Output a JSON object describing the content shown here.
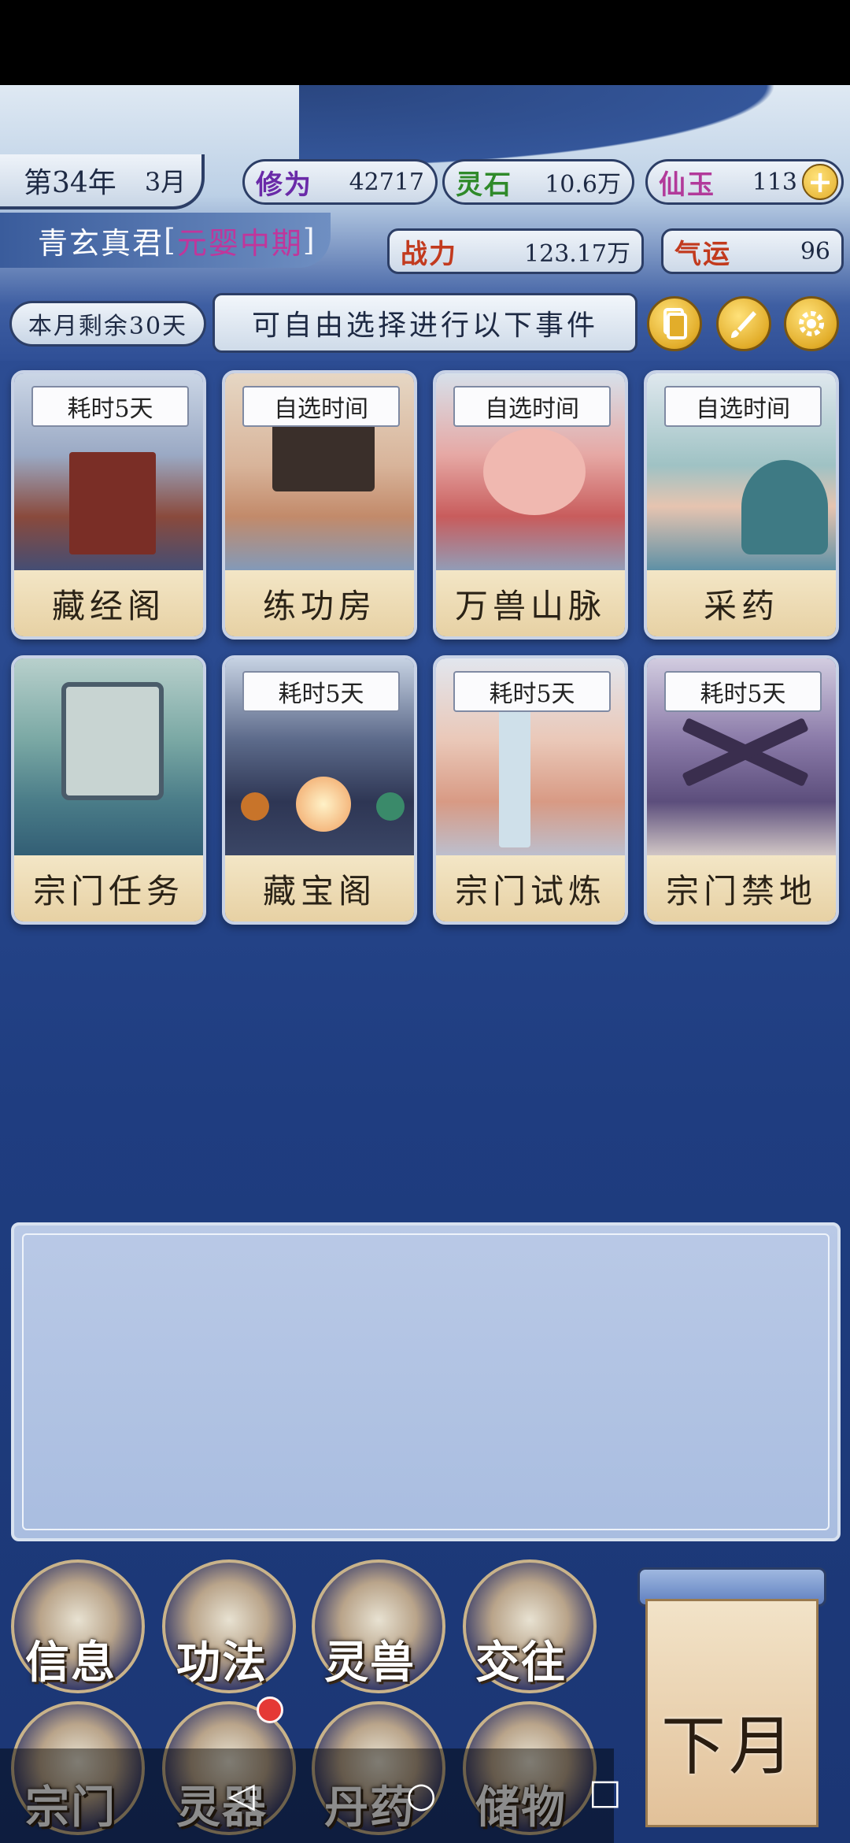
{
  "header": {
    "year": "第34年",
    "month": "3月",
    "cultivation_label": "修为",
    "cultivation_value": "42717",
    "spirit_stone_label": "灵石",
    "spirit_stone_value": "10.6万",
    "jade_label": "仙玉",
    "jade_value": "113",
    "player_name": "青玄真君",
    "realm_open": "[",
    "realm": "元婴中期",
    "realm_close": "]",
    "power_label": "战力",
    "power_value": "123.17万",
    "luck_label": "气运",
    "luck_value": "96",
    "days_left": "本月剩余30天",
    "event_hint": "可自由选择进行以下事件"
  },
  "icons": {
    "add": "plus-icon",
    "cards": "cards-icon",
    "brush": "brush-icon",
    "settings": "gear-icon"
  },
  "events": [
    {
      "tag": "耗时5天",
      "title": "藏经阁"
    },
    {
      "tag": "自选时间",
      "title": "练功房"
    },
    {
      "tag": "自选时间",
      "title": "万兽山脉"
    },
    {
      "tag": "自选时间",
      "title": "采药"
    },
    {
      "tag": "",
      "title": "宗门任务"
    },
    {
      "tag": "耗时5天",
      "title": "藏宝阁"
    },
    {
      "tag": "耗时5天",
      "title": "宗门试炼"
    },
    {
      "tag": "耗时5天",
      "title": "宗门禁地"
    }
  ],
  "menu": [
    {
      "label": "信息"
    },
    {
      "label": "功法"
    },
    {
      "label": "灵兽"
    },
    {
      "label": "交往"
    },
    {
      "label": "宗门"
    },
    {
      "label": "灵器"
    },
    {
      "label": "丹药"
    },
    {
      "label": "储物"
    }
  ],
  "next_month": "下月",
  "colors": {
    "bg": "#2a4a90",
    "realm": "#c0369b",
    "gold": "#e2ad2a"
  }
}
